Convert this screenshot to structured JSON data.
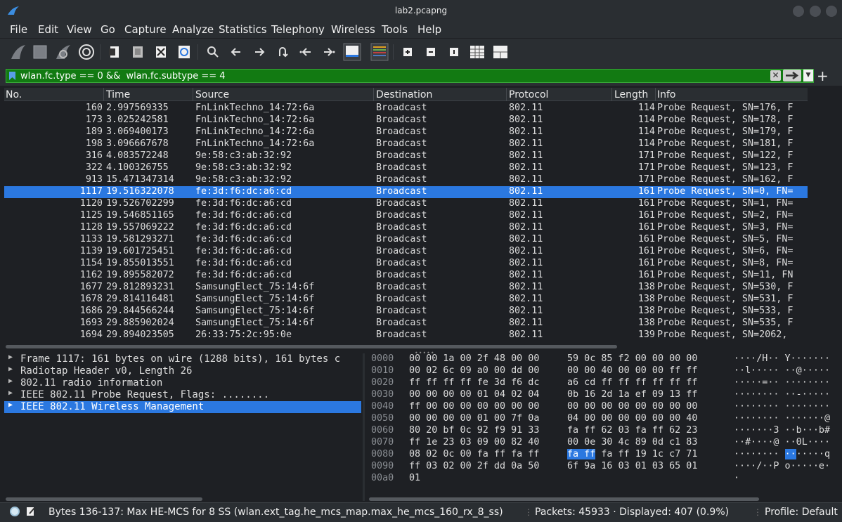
{
  "window": {
    "title": "lab2.pcapng"
  },
  "menu": [
    "File",
    "Edit",
    "View",
    "Go",
    "Capture",
    "Analyze",
    "Statistics",
    "Telephony",
    "Wireless",
    "Tools",
    "Help"
  ],
  "filter": {
    "value": "wlan.fc.type == 0 &&  wlan.fc.subtype == 4"
  },
  "columns": [
    "No.",
    "Time",
    "Source",
    "Destination",
    "Protocol",
    "Length",
    "Info"
  ],
  "packets": [
    {
      "no": "160",
      "time": "2.997569335",
      "src": "FnLinkTechno_14:72:6a",
      "dst": "Broadcast",
      "proto": "802.11",
      "len": "114",
      "info": "Probe Request, SN=176, F"
    },
    {
      "no": "173",
      "time": "3.025242581",
      "src": "FnLinkTechno_14:72:6a",
      "dst": "Broadcast",
      "proto": "802.11",
      "len": "114",
      "info": "Probe Request, SN=178, F"
    },
    {
      "no": "189",
      "time": "3.069400173",
      "src": "FnLinkTechno_14:72:6a",
      "dst": "Broadcast",
      "proto": "802.11",
      "len": "114",
      "info": "Probe Request, SN=179, F"
    },
    {
      "no": "198",
      "time": "3.096667678",
      "src": "FnLinkTechno_14:72:6a",
      "dst": "Broadcast",
      "proto": "802.11",
      "len": "114",
      "info": "Probe Request, SN=181, F"
    },
    {
      "no": "316",
      "time": "4.083572248",
      "src": "9e:58:c3:ab:32:92",
      "dst": "Broadcast",
      "proto": "802.11",
      "len": "171",
      "info": "Probe Request, SN=122, F"
    },
    {
      "no": "322",
      "time": "4.100326755",
      "src": "9e:58:c3:ab:32:92",
      "dst": "Broadcast",
      "proto": "802.11",
      "len": "171",
      "info": "Probe Request, SN=123, F"
    },
    {
      "no": "913",
      "time": "15.471347314",
      "src": "9e:58:c3:ab:32:92",
      "dst": "Broadcast",
      "proto": "802.11",
      "len": "171",
      "info": "Probe Request, SN=162, F"
    },
    {
      "no": "1117",
      "time": "19.516322078",
      "src": "fe:3d:f6:dc:a6:cd",
      "dst": "Broadcast",
      "proto": "802.11",
      "len": "161",
      "info": "Probe Request, SN=0, FN="
    },
    {
      "no": "1120",
      "time": "19.526702299",
      "src": "fe:3d:f6:dc:a6:cd",
      "dst": "Broadcast",
      "proto": "802.11",
      "len": "161",
      "info": "Probe Request, SN=1, FN="
    },
    {
      "no": "1125",
      "time": "19.546851165",
      "src": "fe:3d:f6:dc:a6:cd",
      "dst": "Broadcast",
      "proto": "802.11",
      "len": "161",
      "info": "Probe Request, SN=2, FN="
    },
    {
      "no": "1128",
      "time": "19.557069222",
      "src": "fe:3d:f6:dc:a6:cd",
      "dst": "Broadcast",
      "proto": "802.11",
      "len": "161",
      "info": "Probe Request, SN=3, FN="
    },
    {
      "no": "1133",
      "time": "19.581293271",
      "src": "fe:3d:f6:dc:a6:cd",
      "dst": "Broadcast",
      "proto": "802.11",
      "len": "161",
      "info": "Probe Request, SN=5, FN="
    },
    {
      "no": "1139",
      "time": "19.601725451",
      "src": "fe:3d:f6:dc:a6:cd",
      "dst": "Broadcast",
      "proto": "802.11",
      "len": "161",
      "info": "Probe Request, SN=6, FN="
    },
    {
      "no": "1154",
      "time": "19.855013551",
      "src": "fe:3d:f6:dc:a6:cd",
      "dst": "Broadcast",
      "proto": "802.11",
      "len": "161",
      "info": "Probe Request, SN=8, FN="
    },
    {
      "no": "1162",
      "time": "19.895582072",
      "src": "fe:3d:f6:dc:a6:cd",
      "dst": "Broadcast",
      "proto": "802.11",
      "len": "161",
      "info": "Probe Request, SN=11, FN"
    },
    {
      "no": "1677",
      "time": "29.812893231",
      "src": "SamsungElect_75:14:6f",
      "dst": "Broadcast",
      "proto": "802.11",
      "len": "138",
      "info": "Probe Request, SN=530, F"
    },
    {
      "no": "1678",
      "time": "29.814116481",
      "src": "SamsungElect_75:14:6f",
      "dst": "Broadcast",
      "proto": "802.11",
      "len": "138",
      "info": "Probe Request, SN=531, F"
    },
    {
      "no": "1686",
      "time": "29.844566244",
      "src": "SamsungElect_75:14:6f",
      "dst": "Broadcast",
      "proto": "802.11",
      "len": "138",
      "info": "Probe Request, SN=533, F"
    },
    {
      "no": "1693",
      "time": "29.885902024",
      "src": "SamsungElect_75:14:6f",
      "dst": "Broadcast",
      "proto": "802.11",
      "len": "138",
      "info": "Probe Request, SN=535, F"
    },
    {
      "no": "1694",
      "time": "29.894023505",
      "src": "26:33:75:2c:95:0e",
      "dst": "Broadcast",
      "proto": "802.11",
      "len": "139",
      "info": "Probe Request, SN=2062, "
    }
  ],
  "selected_packet_index": 7,
  "details": [
    "Frame 1117: 161 bytes on wire (1288 bits), 161 bytes c",
    "Radiotap Header v0, Length 26",
    "802.11 radio information",
    "IEEE 802.11 Probe Request, Flags: ........",
    "IEEE 802.11 Wireless Management"
  ],
  "selected_detail_index": 4,
  "hex": [
    {
      "off": "0000",
      "b1": "00 00 1a 00 2f 48 00 00",
      "b2": "59 0c 85 f2 00 00 00 00",
      "asc": "····/H·· Y·······"
    },
    {
      "off": "0010",
      "b1": "00 02 6c 09 a0 00 dd 00",
      "b2": "00 00 40 00 00 00 ff ff",
      "asc": "··l····· ··@·····"
    },
    {
      "off": "0020",
      "b1": "ff ff ff ff fe 3d f6 dc",
      "b2": "a6 cd ff ff ff ff ff ff",
      "asc": "·····=·· ········"
    },
    {
      "off": "0030",
      "b1": "00 00 00 00 01 04 02 04",
      "b2": "0b 16 2d 1a ef 09 13 ff",
      "asc": "········ ··-·····"
    },
    {
      "off": "0040",
      "b1": "ff 00 00 00 00 00 00 00",
      "b2": "00 00 00 00 00 00 00 00",
      "asc": "········ ········"
    },
    {
      "off": "0050",
      "b1": "00 00 00 00 01 00 7f 0a",
      "b2": "04 00 00 00 00 00 00 40",
      "asc": "········ ·······@"
    },
    {
      "off": "0060",
      "b1": "80 20 bf 0c 92 f9 91 33",
      "b2": "fa ff 62 03 fa ff 62 23",
      "asc": "·······3 ··b···b#"
    },
    {
      "off": "0070",
      "b1": "ff 1e 23 03 09 00 82 40",
      "b2": "00 0e 30 4c 89 0d c1 83",
      "asc": "··#····@ ··0L····"
    },
    {
      "off": "0080",
      "b1": "08 02 0c 00 fa ff fa ff",
      "b2": "fa ff fa ff 19 1c c7 71",
      "asc": "········ ·······q"
    },
    {
      "off": "0090",
      "b1": "ff 03 02 00 2f dd 0a 50",
      "b2": "6f 9a 16 03 01 03 65 01",
      "asc": "····/··P o·····e·"
    },
    {
      "off": "00a0",
      "b1": "01",
      "b2": "",
      "asc": "·"
    }
  ],
  "status": {
    "field": "Bytes 136-137: Max HE-MCS for 8 SS (wlan.ext_tag.he_mcs_map.max_he_mcs_160_rx_8_ss)",
    "packets": "Packets: 45933 · Displayed: 407 (0.9%)",
    "profile": "Profile: Default"
  },
  "colors": {
    "selection": "#2b78e0",
    "filter_valid": "#127a12",
    "background": "#1e2024"
  }
}
